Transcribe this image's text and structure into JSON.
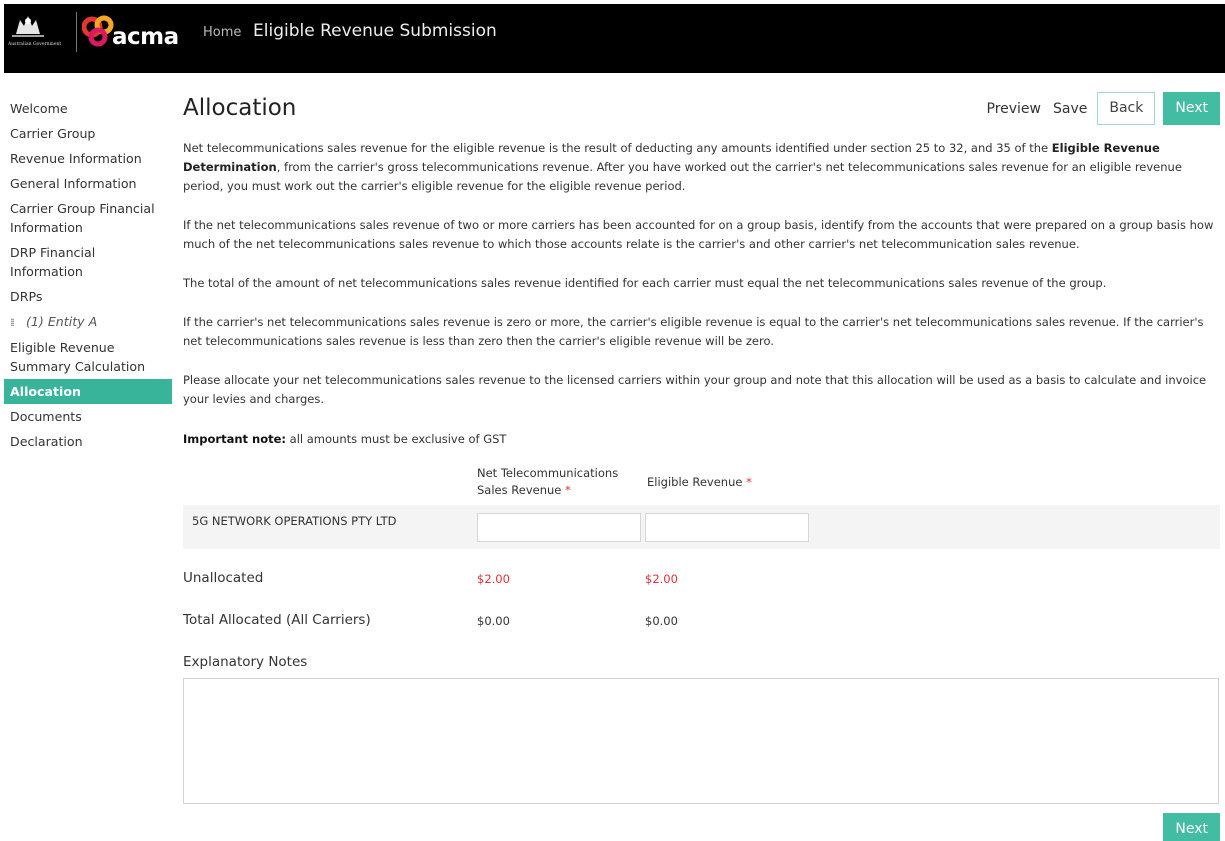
{
  "header": {
    "gov_text": "Australian Government",
    "logo_text": "acma",
    "home_link": "Home",
    "app_title": "Eligible Revenue Submission"
  },
  "sidebar": {
    "items": [
      {
        "label": "Welcome"
      },
      {
        "label": "Carrier Group"
      },
      {
        "label": "Revenue Information"
      },
      {
        "label": "General Information"
      },
      {
        "label": "Carrier Group Financial Information"
      },
      {
        "label": "DRP Financial Information"
      },
      {
        "label": "DRPs"
      },
      {
        "label": "(1) Entity A"
      },
      {
        "label": "Eligible Revenue Summary Calculation"
      },
      {
        "label": "Allocation"
      },
      {
        "label": "Documents"
      },
      {
        "label": "Declaration"
      }
    ],
    "active": "Allocation"
  },
  "main": {
    "title": "Allocation",
    "toolbar": {
      "preview": "Preview",
      "save": "Save",
      "back": "Back",
      "next": "Next"
    },
    "para1_a": "Net telecommunications sales revenue for the eligible revenue is the result of deducting any amounts identified under section 25 to 32, and 35 of the ",
    "para1_link": "Eligible Revenue Determination",
    "para1_b": ", from the carrier's gross telecommunications revenue. After you have worked out the carrier's net telecommunications sales revenue for an eligible revenue period, you must work out the carrier's eligible revenue for the eligible revenue period.",
    "para2": "If the net telecommunications sales revenue of two or more carriers has been accounted for on a group basis, identify from the accounts that were prepared on a group basis how much of the net telecommunications sales revenue to which those accounts relate is the carrier's and other carrier's net telecommunication sales revenue.",
    "para3": "The total of the amount of net telecommunications sales revenue identified for each carrier must equal the net telecommunications sales revenue of the group.",
    "para4": "If the carrier's net telecommunications sales revenue is zero or more, the carrier's eligible revenue is equal to the carrier's net telecommunications sales revenue. If the carrier's net telecommunications sales revenue is less than zero then the carrier's eligible revenue will be zero.",
    "para5": "Please allocate your net telecommunications sales revenue to the licensed carriers within your group and note that this allocation will be used as a basis to calculate and invoice your levies and charges.",
    "important_label": "Important note:",
    "important_text": " all amounts must be exclusive of GST",
    "columns": {
      "net_revenue": "Net Telecommunications Sales Revenue",
      "eligible_revenue": "Eligible Revenue",
      "required_mark": "*"
    },
    "carrier": {
      "name": "5G NETWORK OPERATIONS PTY LTD",
      "net_value": "",
      "eligible_value": ""
    },
    "unallocated": {
      "label": "Unallocated",
      "net": "$2.00",
      "eligible": "$2.00"
    },
    "total_allocated": {
      "label": "Total Allocated (All Carriers)",
      "net": "$0.00",
      "eligible": "$0.00"
    },
    "notes": {
      "label": "Explanatory Notes",
      "value": ""
    },
    "bottom_next": "Next"
  }
}
